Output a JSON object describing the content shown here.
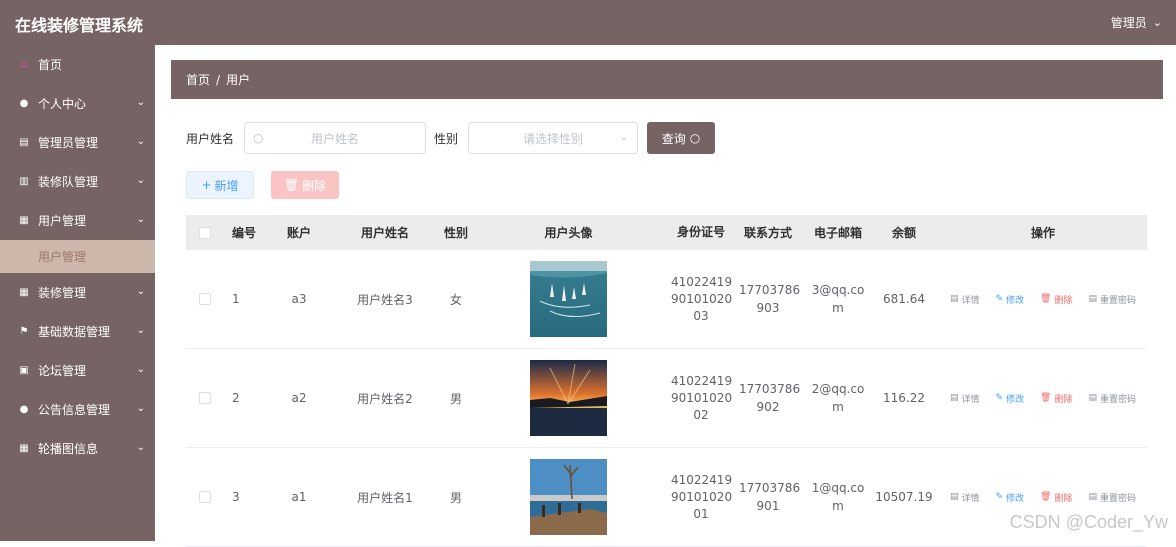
{
  "header": {
    "title": "在线装修管理系统",
    "user": "管理员"
  },
  "sidebar": {
    "items": [
      {
        "label": "首页",
        "icon": "home-icon"
      },
      {
        "label": "个人中心",
        "icon": "user-icon"
      },
      {
        "label": "管理员管理",
        "icon": "doc-icon"
      },
      {
        "label": "装修队管理",
        "icon": "bars-icon"
      },
      {
        "label": "用户管理",
        "icon": "grid-icon"
      },
      {
        "label": "装修管理",
        "icon": "grid-icon"
      },
      {
        "label": "基础数据管理",
        "icon": "flag-icon"
      },
      {
        "label": "论坛管理",
        "icon": "image-icon"
      },
      {
        "label": "公告信息管理",
        "icon": "user-icon"
      },
      {
        "label": "轮播图信息",
        "icon": "grid-icon"
      }
    ],
    "active_sub": "用户管理"
  },
  "breadcrumb": {
    "home": "首页",
    "sep": "/",
    "current": "用户"
  },
  "search": {
    "name_label": "用户姓名",
    "name_placeholder": "用户姓名",
    "sex_label": "性别",
    "sex_placeholder": "请选择性别",
    "query_label": "查询"
  },
  "actions": {
    "add_label": "新增",
    "delete_label": "删除"
  },
  "table": {
    "headers": [
      "编号",
      "账户",
      "用户姓名",
      "性别",
      "用户头像",
      "身份证号",
      "联系方式",
      "电子邮箱",
      "余额",
      "操作"
    ],
    "ops": {
      "detail": "详情",
      "edit": "修改",
      "delete": "删除",
      "reset": "重置密码"
    },
    "rows": [
      {
        "id": "1",
        "account": "a3",
        "name": "用户姓名3",
        "sex": "女",
        "idno": [
          "41022419",
          "90101020",
          "03"
        ],
        "phone": [
          "17703786",
          "903"
        ],
        "email": [
          "3@qq.co",
          "m"
        ],
        "balance": "681.64"
      },
      {
        "id": "2",
        "account": "a2",
        "name": "用户姓名2",
        "sex": "男",
        "idno": [
          "41022419",
          "90101020",
          "02"
        ],
        "phone": [
          "17703786",
          "902"
        ],
        "email": [
          "2@qq.co",
          "m"
        ],
        "balance": "116.22"
      },
      {
        "id": "3",
        "account": "a1",
        "name": "用户姓名1",
        "sex": "男",
        "idno": [
          "41022419",
          "90101020",
          "01"
        ],
        "phone": [
          "17703786",
          "901"
        ],
        "email": [
          "1@qq.co",
          "m"
        ],
        "balance": "10507.19"
      }
    ]
  },
  "watermark": "CSDN @Coder_Yw"
}
